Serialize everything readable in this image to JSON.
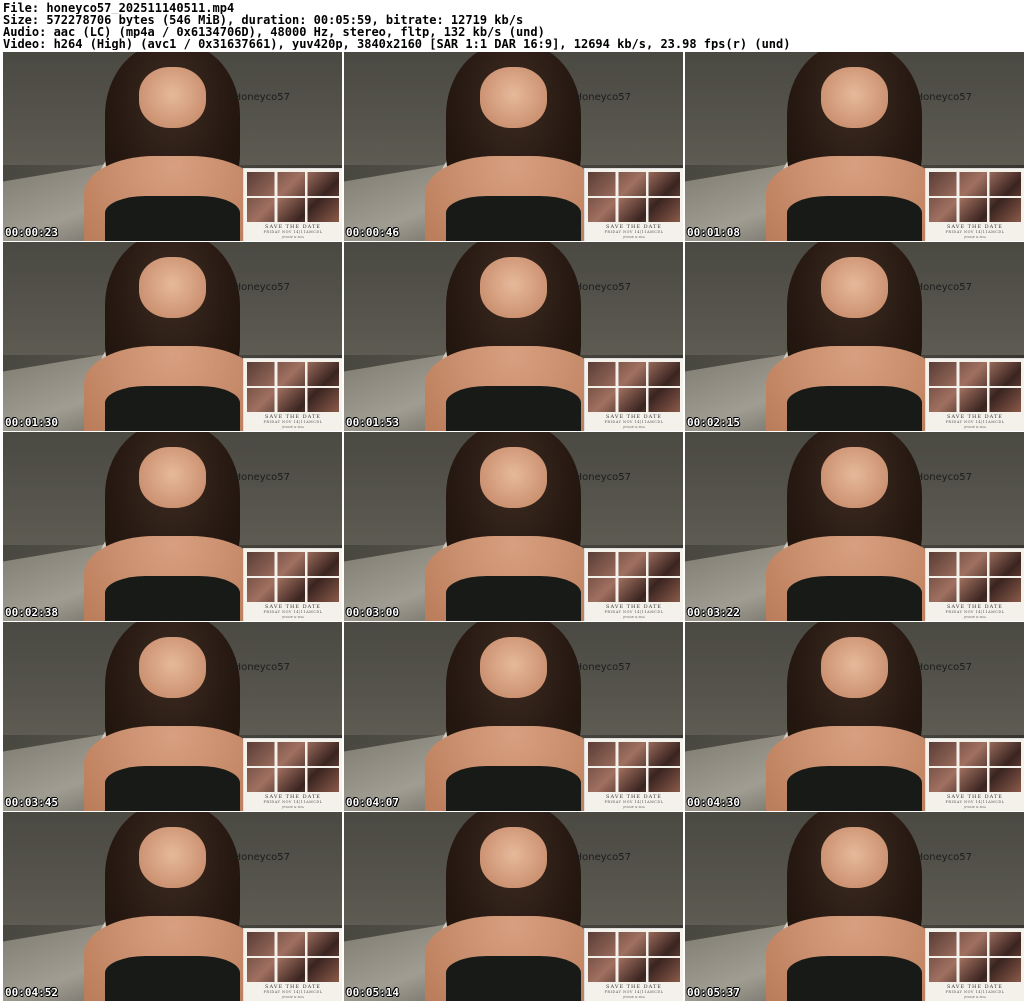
{
  "header": {
    "file": "File: honeyco57_202511140511.mp4",
    "size": "Size: 572278706 bytes (546 MiB), duration: 00:05:59, bitrate: 12719 kb/s",
    "audio": "Audio: aac (LC) (mp4a / 0x6134706D), 48000 Hz, stereo, fltp, 132 kb/s (und)",
    "video": "Video: h264 (High) (avc1 / 0x31637661), yuv420p, 3840x2160 [SAR 1:1 DAR 16:9], 12694 kb/s, 23.98 fps(r) (und)"
  },
  "thumbnails": [
    {
      "timestamp": "00:00:23",
      "watermark": "Honeyco57"
    },
    {
      "timestamp": "00:00:46",
      "watermark": "Honeyco57"
    },
    {
      "timestamp": "00:01:08",
      "watermark": "Honeyco57"
    },
    {
      "timestamp": "00:01:30",
      "watermark": "Honeyco57"
    },
    {
      "timestamp": "00:01:53",
      "watermark": "Honeyco57"
    },
    {
      "timestamp": "00:02:15",
      "watermark": "Honeyco57"
    },
    {
      "timestamp": "00:02:38",
      "watermark": "Honeyco57"
    },
    {
      "timestamp": "00:03:00",
      "watermark": "Honeyco57"
    },
    {
      "timestamp": "00:03:22",
      "watermark": "Honeyco57"
    },
    {
      "timestamp": "00:03:45",
      "watermark": "Honeyco57"
    },
    {
      "timestamp": "00:04:07",
      "watermark": "Honeyco57"
    },
    {
      "timestamp": "00:04:30",
      "watermark": "Honeyco57"
    },
    {
      "timestamp": "00:04:52",
      "watermark": "Honeyco57"
    },
    {
      "timestamp": "00:05:14",
      "watermark": "Honeyco57"
    },
    {
      "timestamp": "00:05:37",
      "watermark": "Honeyco57"
    }
  ],
  "inset_card": {
    "line1": "SAVE THE DATE",
    "line2": "FRIDAY NOV 14|11AMCDL",
    "line3": "JESSIE & MIA"
  }
}
